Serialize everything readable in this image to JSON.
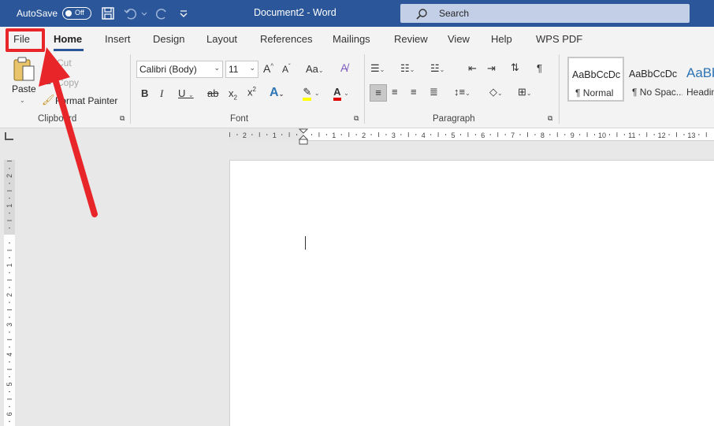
{
  "titlebar": {
    "autosave_label": "AutoSave",
    "autosave_state": "Off",
    "doc_title": "Document2  -  Word",
    "search_placeholder": "Search"
  },
  "tabs": [
    "File",
    "Home",
    "Insert",
    "Design",
    "Layout",
    "References",
    "Mailings",
    "Review",
    "View",
    "Help",
    "WPS PDF"
  ],
  "clipboard": {
    "paste": "Paste",
    "cut": "Cut",
    "copy": "Copy",
    "format_painter": "Format Painter",
    "group_label": "Clipboard"
  },
  "font": {
    "name": "Calibri (Body)",
    "size": "11",
    "group_label": "Font"
  },
  "paragraph": {
    "group_label": "Paragraph"
  },
  "styles": [
    {
      "preview": "AaBbCcDc",
      "name": "¶ Normal"
    },
    {
      "preview": "AaBbCcDc",
      "name": "¶ No Spac..."
    },
    {
      "preview": "AaBb",
      "name": "Headin"
    }
  ],
  "ruler": {
    "h_labels": [
      "2",
      "1",
      "1",
      "2",
      "3",
      "4",
      "5",
      "6",
      "7",
      "8",
      "9",
      "10",
      "11",
      "12",
      "13"
    ],
    "v_labels": [
      "2",
      "1",
      "1",
      "2",
      "3",
      "4",
      "5",
      "6"
    ]
  },
  "colors": {
    "accent": "#2b579a",
    "annotation": "#e8262a"
  }
}
